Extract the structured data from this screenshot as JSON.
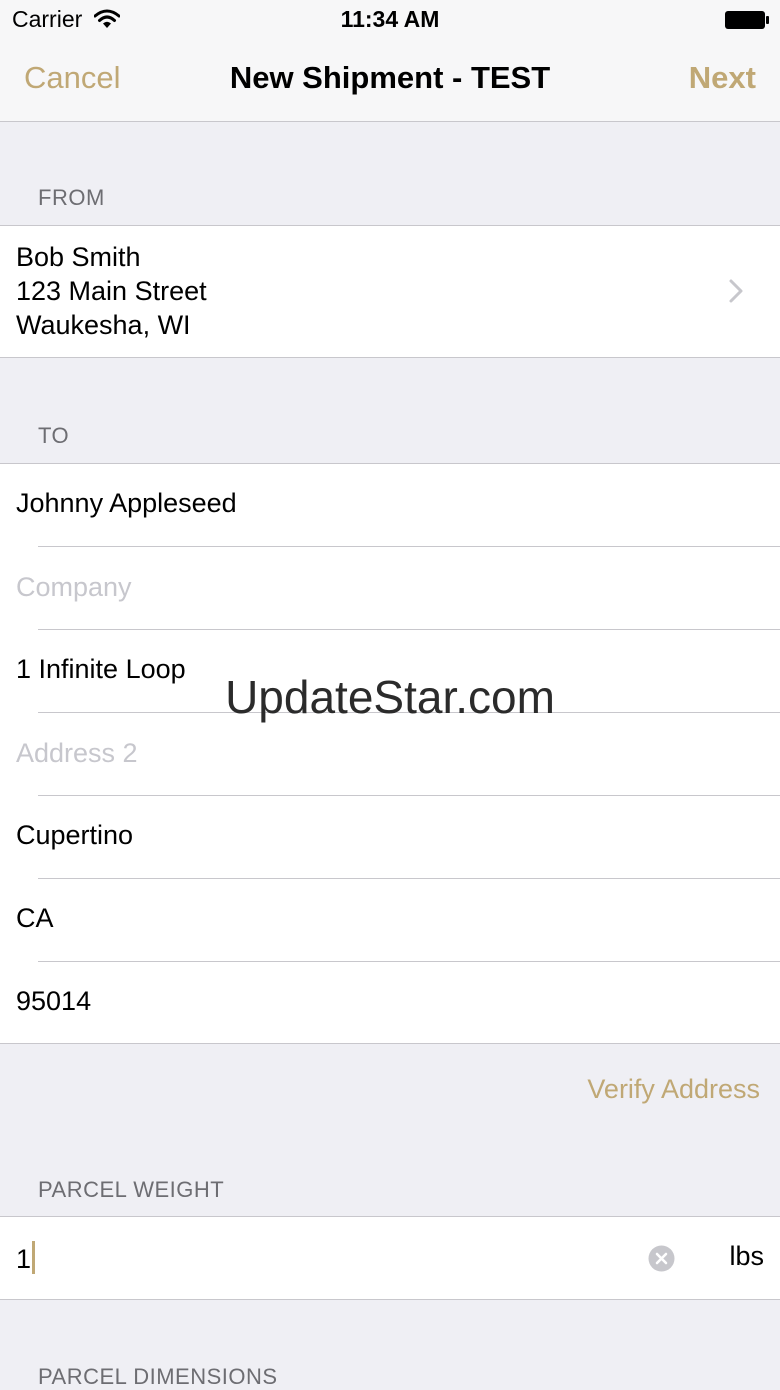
{
  "status_bar": {
    "carrier": "Carrier",
    "time": "11:34 AM",
    "icons": [
      "wifi-icon",
      "battery-icon"
    ]
  },
  "nav": {
    "cancel_label": "Cancel",
    "title": "New Shipment - TEST",
    "next_label": "Next"
  },
  "from": {
    "header": "FROM",
    "name": "Bob Smith",
    "street": "123 Main Street",
    "city_state": "Waukesha, WI"
  },
  "to": {
    "header": "TO",
    "name": "Johnny Appleseed",
    "company_placeholder": "Company",
    "address1": "1 Infinite Loop",
    "address2_placeholder": "Address 2",
    "city": "Cupertino",
    "state": "CA",
    "zip": "95014"
  },
  "verify_label": "Verify Address",
  "parcel_weight": {
    "header": "PARCEL WEIGHT",
    "value": "1",
    "unit": "lbs"
  },
  "parcel_dimensions": {
    "header": "PARCEL DIMENSIONS"
  },
  "watermark": "UpdateStar.com",
  "colors": {
    "accent": "#c0a875",
    "background": "#efeff4",
    "separator": "#c8c7cc",
    "section_header": "#6d6d72",
    "placeholder": "#c7c7cd"
  }
}
